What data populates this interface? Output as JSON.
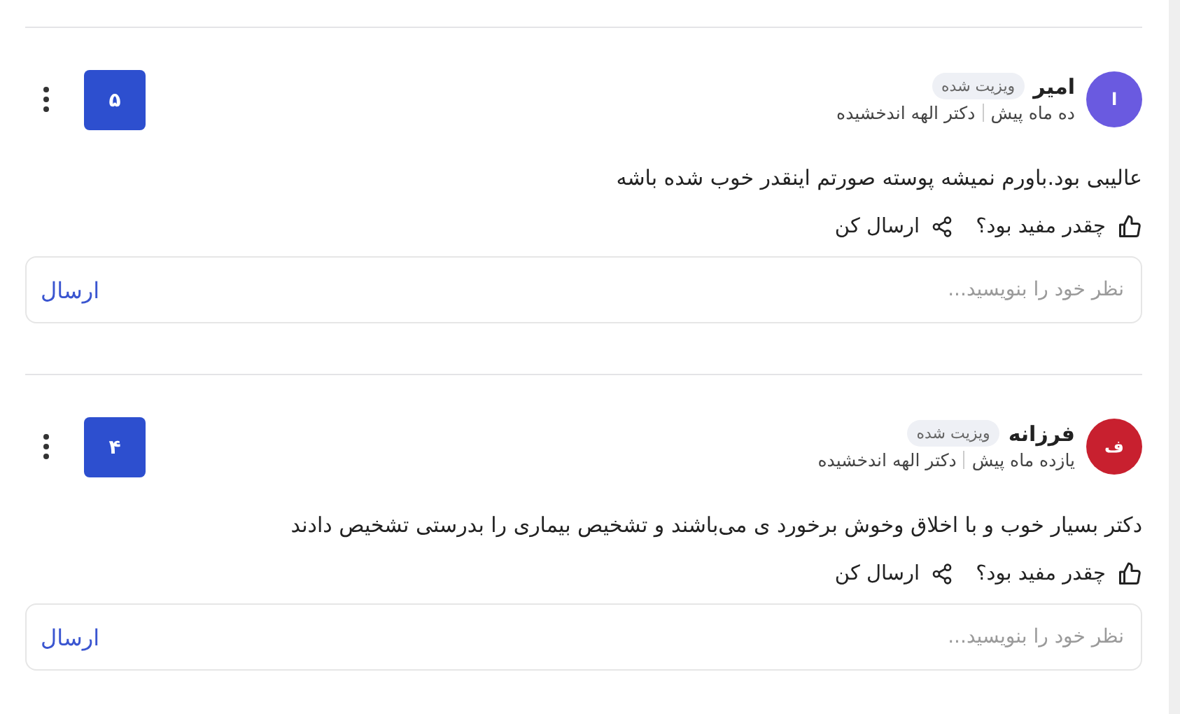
{
  "reviews": [
    {
      "avatar_letter": "ا",
      "color": "#6a5ae0",
      "name": "امیر",
      "badge": "ویزیت شده",
      "time": "ده ماه پیش",
      "doctor": "دکتر الهه اندخشیده",
      "rating": "۵",
      "text": "عالیبی بود.باورم نمیشه پوسته صورتم اینقدر خوب شده باشه",
      "helpful": "چقدر مفید بود؟",
      "share": "ارسال کن",
      "reply": {
        "placeholder": "نظر خود را بنویسید...",
        "button": "ارسال"
      }
    },
    {
      "avatar_letter": "ف",
      "color": "#c8202f",
      "name": "فرزانه",
      "badge": "ویزیت شده",
      "time": "یازده ماه پیش",
      "doctor": "دکتر الهه اندخشیده",
      "rating": "۴",
      "text": "دکتر بسیار خوب و با اخلاق وخوش برخورد ی می‌باشند و تشخیص بیماری را بدرستی تشخیص دادند",
      "helpful": "چقدر مفید بود؟",
      "share": "ارسال کن",
      "reply": {
        "placeholder": "نظر خود را بنویسید...",
        "button": "ارسال"
      }
    }
  ]
}
